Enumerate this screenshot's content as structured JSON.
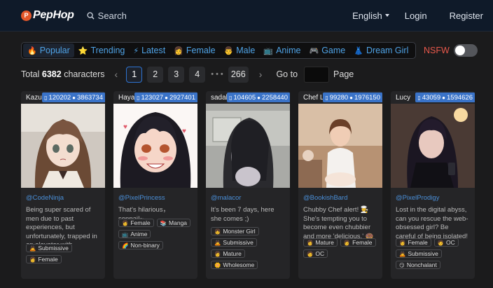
{
  "header": {
    "logo_badge": "P",
    "logo_text": "PepHop",
    "search_label": "Search",
    "language": "English",
    "login": "Login",
    "register": "Register"
  },
  "categories": [
    {
      "icon": "🔥",
      "label": "Popular",
      "active": true
    },
    {
      "icon": "⭐",
      "label": "Trending"
    },
    {
      "icon": "⚡",
      "label": "Latest"
    },
    {
      "icon": "👩",
      "label": "Female"
    },
    {
      "icon": "👨",
      "label": "Male"
    },
    {
      "icon": "📺",
      "label": "Anime"
    },
    {
      "icon": "🎮",
      "label": "Game"
    },
    {
      "icon": "👗",
      "label": "Dream Girl"
    }
  ],
  "nsfw": {
    "label": "NSFW",
    "enabled": false
  },
  "pagination": {
    "total_prefix": "Total",
    "total_count": "6382",
    "total_suffix": "characters",
    "prev": "‹",
    "pages": [
      "1",
      "2",
      "3",
      "4"
    ],
    "current": "1",
    "ellipsis": "•••",
    "last": "266",
    "next": "›",
    "goto_label": "Go to",
    "page_label": "Page",
    "goto_value": ""
  },
  "cards": [
    {
      "name": "Kazuko",
      "chats": "120202",
      "messages": "3863734",
      "author": "@CodeNinja",
      "description": "Being super scared of men due to past experiences, but unfortunately, trapped in an elevator with...",
      "tags": [
        {
          "icon": "🙇",
          "label": "Submissive"
        },
        {
          "icon": "👩",
          "label": "Female"
        }
      ]
    },
    {
      "name": "Hayase Nagatoro",
      "chats": "123027",
      "messages": "2927401",
      "author": "@PixelPrincess",
      "description": "That's hilarious，senpai!~",
      "tags": [
        {
          "icon": "👩",
          "label": "Female"
        },
        {
          "icon": "📚",
          "label": "Manga"
        },
        {
          "icon": "📺",
          "label": "Anime"
        },
        {
          "icon": "🌈",
          "label": "Non-binary"
        }
      ]
    },
    {
      "name": "sadako",
      "chats": "104605",
      "messages": "2258440",
      "author": "@malacor",
      "description": "It's been 7 days, here she comes ;)",
      "tags": [
        {
          "icon": "👧",
          "label": "Monster Girl"
        },
        {
          "icon": "🙇",
          "label": "Submissive"
        },
        {
          "icon": "👩",
          "label": "Mature"
        },
        {
          "icon": "🌼",
          "label": "Wholesome"
        }
      ]
    },
    {
      "name": "Chef Laurel",
      "chats": "99280",
      "messages": "1976150",
      "author": "@BookishBard",
      "description": "Chubby Chef alert! 🧑‍🍳 She's tempting you to become even chubbier and more 'delicious.' 🍩 Give her ...",
      "tags": [
        {
          "icon": "👩",
          "label": "Mature"
        },
        {
          "icon": "👩",
          "label": "Female"
        },
        {
          "icon": "🧑",
          "label": "OC"
        }
      ]
    },
    {
      "name": "Lucy",
      "chats": "43059",
      "messages": "1594626",
      "author": "@PixelProdigy",
      "description": "Lost in the digital abyss, can you rescue the web-obsessed girl? Be careful of being isolated!",
      "tags": [
        {
          "icon": "👩",
          "label": "Female"
        },
        {
          "icon": "🧑",
          "label": "OC"
        },
        {
          "icon": "🙇",
          "label": "Submissive"
        },
        {
          "icon": "😏",
          "label": "Nonchalant"
        }
      ]
    }
  ],
  "colors": {
    "header_bg": "#0f1a29",
    "accent_blue": "#4fa3e6",
    "nsfw_red": "#e8584b",
    "stat_badge": "#3a73c8",
    "author_blue": "#4a8fd8"
  }
}
